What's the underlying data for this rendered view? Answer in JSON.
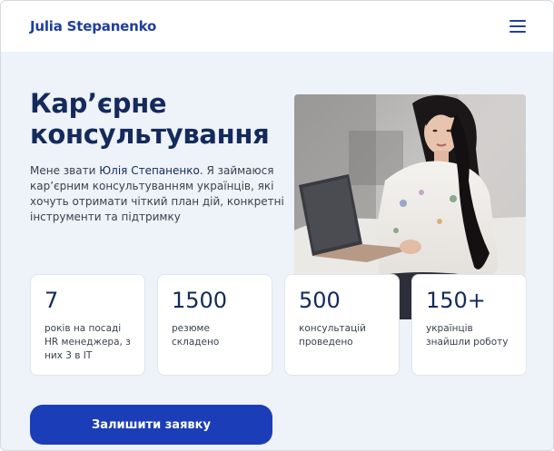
{
  "header": {
    "brand": "Julia Stepanenko",
    "menu_icon": "hamburger-menu-icon"
  },
  "hero": {
    "title_line1": "Кар’єрне",
    "title_line2": "консультування",
    "text_before": "Мене звати ",
    "text_name": "Юлія Степаненко",
    "text_after": ". Я займаюся кар’єрним консультуванням українців, які хочуть отримати чіткий план дій, конкретні інструменти та підтримку",
    "photo": "portrait-photo"
  },
  "stats": [
    {
      "value": "7",
      "label": "років на посаді HR менеджера, з них 3 в IT"
    },
    {
      "value": "1500",
      "label": "резюме складено"
    },
    {
      "value": "500",
      "label": "консультацій проведено"
    },
    {
      "value": "150+",
      "label": "українців знайшли роботу"
    }
  ],
  "cta": {
    "label": "Залишити заявку"
  },
  "colors": {
    "brand": "#1f3f9e",
    "title": "#142a5c",
    "cta": "#1c3db8",
    "page_bg": "#eef2f9"
  }
}
